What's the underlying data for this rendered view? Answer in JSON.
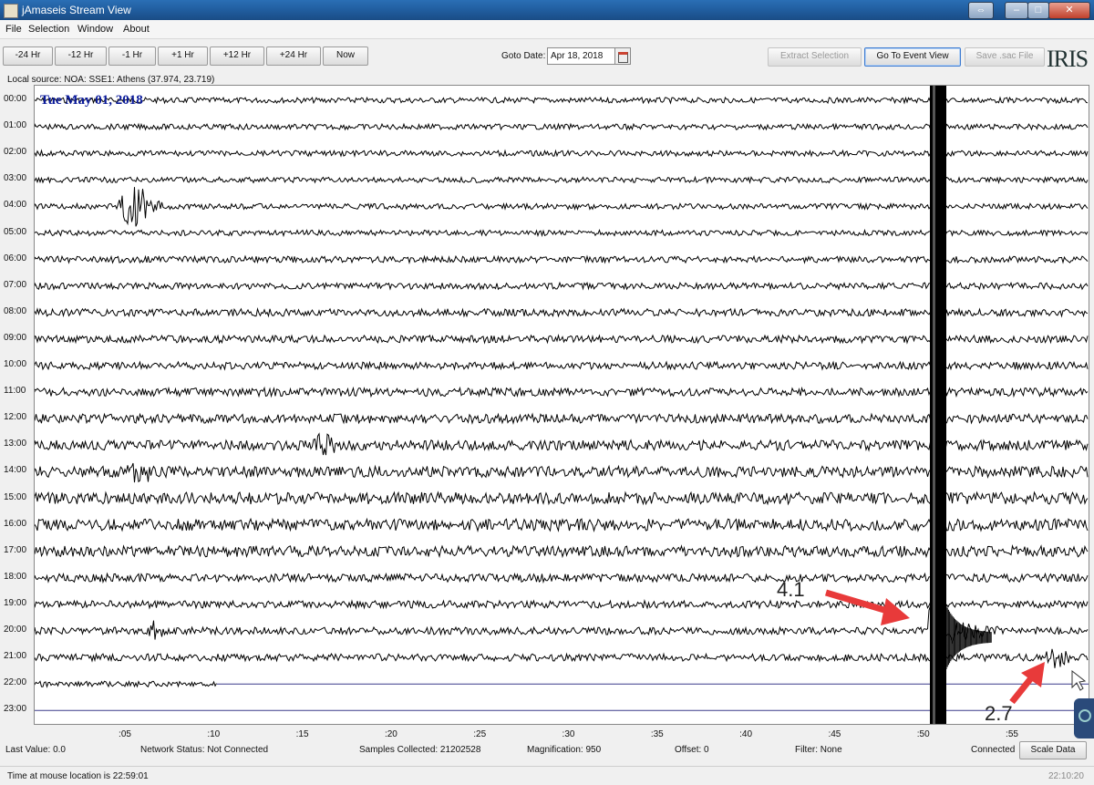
{
  "window": {
    "title": "jAmaseis Stream View"
  },
  "menu": [
    "File",
    "Selection",
    "Window",
    "About"
  ],
  "toolbar": {
    "nav_buttons": [
      "-24 Hr",
      "-12 Hr",
      "-1 Hr",
      "+1 Hr",
      "+12 Hr",
      "+24 Hr",
      "Now"
    ],
    "goto_label": "Goto Date:",
    "goto_value": "Apr 18, 2018",
    "extract_label": "Extract Selection",
    "event_view_label": "Go To Event View",
    "save_label": "Save .sac File",
    "logo_text": "IRIS"
  },
  "source_label": "Local source: NOA: SSE1: Athens (37.974, 23.719)",
  "date_overlay": "Tue May 01, 2018",
  "hours": [
    "00:00",
    "01:00",
    "02:00",
    "03:00",
    "04:00",
    "05:00",
    "06:00",
    "07:00",
    "08:00",
    "09:00",
    "10:00",
    "11:00",
    "12:00",
    "13:00",
    "14:00",
    "15:00",
    "16:00",
    "17:00",
    "18:00",
    "19:00",
    "20:00",
    "21:00",
    "22:00",
    "23:00"
  ],
  "minutes": [
    ":05",
    ":10",
    ":15",
    ":20",
    ":25",
    ":30",
    ":35",
    ":40",
    ":45",
    ":50",
    ":55"
  ],
  "annotations": {
    "big_event": "4.1",
    "small_event": "2.7"
  },
  "status": {
    "last_value": "Last Value:  0.0",
    "network": "Network Status:  Not Connected",
    "samples": "Samples Collected:  21202528",
    "magnification": "Magnification:  950",
    "offset": "Offset:  0",
    "filter": "Filter:  None",
    "connected": "Connected",
    "scale_label": "Scale Data"
  },
  "mouse_location": "Time at mouse location is 22:59:01",
  "clock": "22:10:20",
  "colors": {
    "arrow": "#e83a3a",
    "trace": "#000000",
    "date_text": "#0a1a9a",
    "titlebar": "#1f5a9a"
  }
}
